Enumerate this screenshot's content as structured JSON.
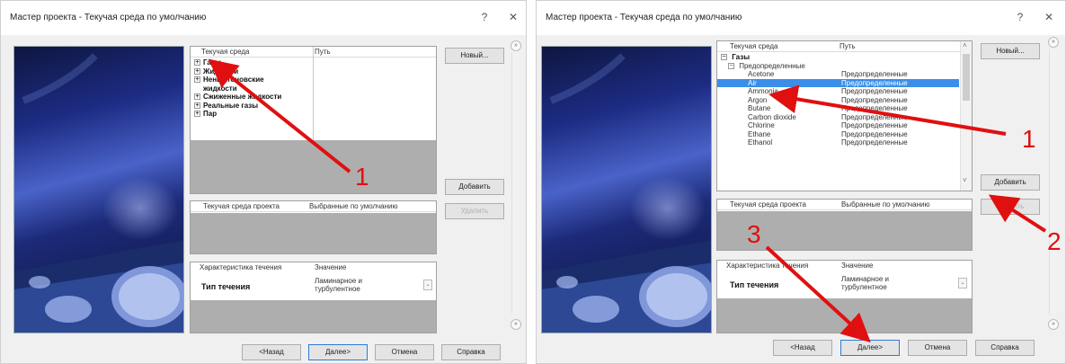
{
  "left": {
    "title": "Мастер проекта - Текучая среда по умолчанию",
    "help": "?",
    "close": "✕",
    "env_header": {
      "col1": "Текучая среда",
      "col2": "Путь"
    },
    "env_items": [
      {
        "expander": "+",
        "label": "Газы"
      },
      {
        "expander": "+",
        "label": "Жидкости"
      },
      {
        "expander": "+",
        "label": "Неньютоновские"
      },
      {
        "expander": "",
        "label": "жидкости"
      },
      {
        "expander": "+",
        "label": "Сжиженные жидкости"
      },
      {
        "expander": "+",
        "label": "Реальные газы"
      },
      {
        "expander": "+",
        "label": "Пар"
      }
    ],
    "project_header": {
      "col1": "Текучая среда проекта",
      "col2": "Выбранные по умолчанию"
    },
    "flow_header": {
      "col1": "Характеристика течения",
      "col2": "Значение"
    },
    "flow_row": {
      "label": "Тип течения",
      "value_line1": "Ламинарное и",
      "value_line2": "турбулентное",
      "dropdown": "⌄"
    },
    "buttons": {
      "new": "Новый...",
      "add": "Добавить",
      "remove": "Удалить",
      "back": "<Назад",
      "next": "Далее>",
      "cancel": "Отмена",
      "help": "Справка"
    },
    "collapse_icons": {
      "top": "»",
      "bottom": "»"
    },
    "markers": {
      "m1": "1"
    }
  },
  "right": {
    "title": "Мастер проекта - Текучая среда по умолчанию",
    "help": "?",
    "close": "✕",
    "env_header": {
      "col1": "Текучая среда",
      "col2": "Путь"
    },
    "gas_group": {
      "expander": "−",
      "label": "Газы"
    },
    "predef_group": {
      "expander": "−",
      "label": "Предопределенные"
    },
    "gases": [
      {
        "name": "Acetone",
        "path": "Предопределенные"
      },
      {
        "name": "Air",
        "path": "Предопределенные"
      },
      {
        "name": "Ammonia",
        "path": "Предопределенные"
      },
      {
        "name": "Argon",
        "path": "Предопределенные"
      },
      {
        "name": "Butane",
        "path": "Предопределенные"
      },
      {
        "name": "Carbon dioxide",
        "path": "Предопределенные"
      },
      {
        "name": "Chlorine",
        "path": "Предопределенные"
      },
      {
        "name": "Ethane",
        "path": "Предопределенные"
      },
      {
        "name": "Ethanol",
        "path": "Предопределенные"
      }
    ],
    "selected_gas": "Air",
    "scroll": {
      "up": "˄",
      "down": "˅"
    },
    "project_header": {
      "col1": "Текучая среда проекта",
      "col2": "Выбранные по умолчанию"
    },
    "flow_header": {
      "col1": "Характеристика течения",
      "col2": "Значение"
    },
    "flow_row": {
      "label": "Тип течения",
      "value_line1": "Ламинарное и",
      "value_line2": "турбулентное",
      "dropdown": "⌄"
    },
    "buttons": {
      "new": "Новый...",
      "add": "Добавить",
      "remove": "Удалить",
      "back": "<Назад",
      "next": "Далее>",
      "cancel": "Отмена",
      "help": "Справка"
    },
    "collapse_icons": {
      "top": "»",
      "bottom": "»"
    },
    "markers": {
      "m1": "1",
      "m2": "2",
      "m3": "3"
    }
  },
  "colors": {
    "selection": "#3b8ee8",
    "arrow": "#e01010",
    "empty_area": "#aeaeae",
    "dialog_bg": "#f0f0f0"
  },
  "icons": [
    "expand-plus-icon",
    "collapse-minus-icon",
    "help-icon",
    "close-icon",
    "collapse-panel-icon",
    "dropdown-chevron-icon",
    "scroll-up-icon",
    "scroll-down-icon"
  ]
}
